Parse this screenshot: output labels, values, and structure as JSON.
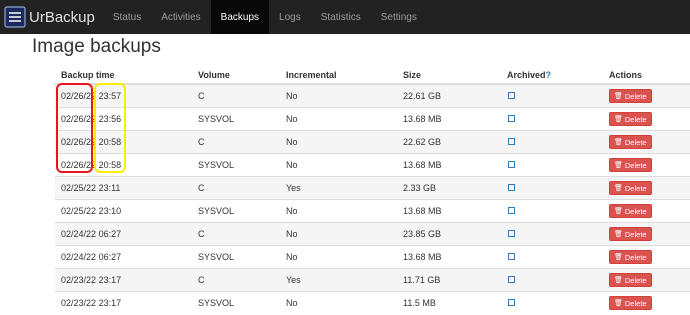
{
  "brand": {
    "name": "UrBackup"
  },
  "nav": [
    "Status",
    "Activities",
    "Backups",
    "Logs",
    "Statistics",
    "Settings"
  ],
  "page_title": "Image backups",
  "columns": {
    "backup_time": "Backup time",
    "volume": "Volume",
    "incremental": "Incremental",
    "size": "Size",
    "archived": "Archived",
    "archived_help": "?",
    "actions": "Actions"
  },
  "delete_label": "Delete",
  "rows": [
    {
      "date": "02/26/22",
      "time": "23:57",
      "volume": "C",
      "incremental": "No",
      "size": "22.61 GB"
    },
    {
      "date": "02/26/22",
      "time": "23:56",
      "volume": "SYSVOL",
      "incremental": "No",
      "size": "13.68 MB"
    },
    {
      "date": "02/26/22",
      "time": "20:58",
      "volume": "C",
      "incremental": "No",
      "size": "22.62 GB"
    },
    {
      "date": "02/26/22",
      "time": "20:58",
      "volume": "SYSVOL",
      "incremental": "No",
      "size": "13.68 MB"
    },
    {
      "date": "02/25/22",
      "time": "23:11",
      "volume": "C",
      "incremental": "Yes",
      "size": "2.33 GB"
    },
    {
      "date": "02/25/22",
      "time": "23:10",
      "volume": "SYSVOL",
      "incremental": "No",
      "size": "13.68 MB"
    },
    {
      "date": "02/24/22",
      "time": "06:27",
      "volume": "C",
      "incremental": "No",
      "size": "23.85 GB"
    },
    {
      "date": "02/24/22",
      "time": "06:27",
      "volume": "SYSVOL",
      "incremental": "No",
      "size": "13.68 MB"
    },
    {
      "date": "02/23/22",
      "time": "23:17",
      "volume": "C",
      "incremental": "Yes",
      "size": "11.71 GB"
    },
    {
      "date": "02/23/22",
      "time": "23:17",
      "volume": "SYSVOL",
      "incremental": "No",
      "size": "11.5 MB"
    }
  ],
  "colors": {
    "navbar": "#222222",
    "nav_active": "#080808",
    "delete_button": "#d9534f",
    "archive_checkbox": "#337ab7",
    "highlight_date": "#e8141e",
    "highlight_time": "#f7ee00"
  }
}
